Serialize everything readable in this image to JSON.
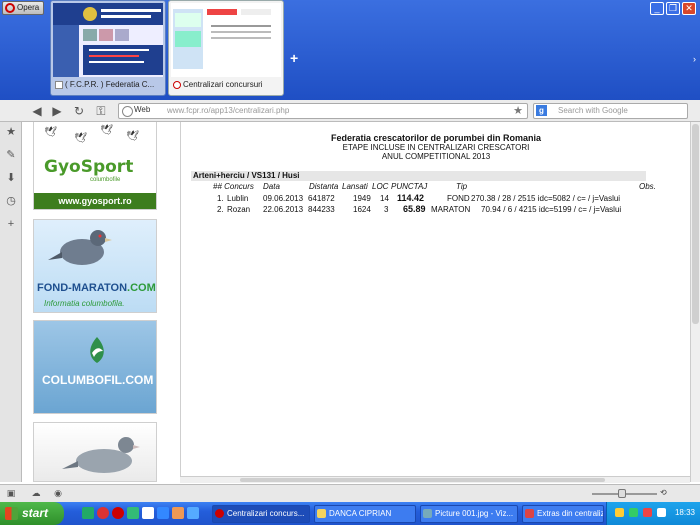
{
  "browser": {
    "menu_label": "Opera",
    "tabs": [
      {
        "label": "( F.C.P.R. ) Federatia C..."
      },
      {
        "label": "Centralizari concursuri"
      }
    ],
    "new_tab_label": "+",
    "address": {
      "scheme_label": "Web",
      "url_host": "www.fcpr.ro",
      "url_path": "/app13/centralizari.php"
    },
    "search_placeholder": "Search with Google",
    "search_engine": "g"
  },
  "sidebar_ads": [
    {
      "brand": "GyoSport",
      "sub": "columbofile",
      "strip": "www.gyosport.ro"
    },
    {
      "brand_a": "FOND-MARATON",
      "brand_b": ".COM",
      "sub": "Informatia columbofila."
    },
    {
      "brand": "COLUMBOFIL.COM"
    }
  ],
  "page": {
    "title": "Federatia crescatorilor de porumbei din Romania",
    "subtitle": "ETAPE INCLUSE IN CENTRALIZARI CRESCATORI",
    "season": "ANUL COMPETITIONAL 2013",
    "group_header": "Arteni+herciu / VS131 / Husi",
    "columns": [
      "## Concurs",
      "Data",
      "Distanta",
      "Lansati",
      "LOC",
      "PUNCTAJ",
      "Tip",
      "Obs."
    ],
    "rows": [
      {
        "nr": "1.",
        "concurs": "Lublin",
        "data": "09.06.2013",
        "distanta": "641872",
        "lansati": "1949",
        "loc": "14",
        "punctaj": "114.42",
        "tip": "FOND",
        "obs": "270.38 / 28 / 2515 idc=5082 / c= / j=Vaslui"
      },
      {
        "nr": "2.",
        "concurs": "Rozan",
        "data": "22.06.2013",
        "distanta": "844233",
        "lansati": "1624",
        "loc": "3",
        "punctaj": "65.89",
        "tip": "MARATON",
        "obs": "70.94 / 6 / 4215 idc=5199 / c= / j=Vaslui"
      }
    ]
  },
  "taskbar": {
    "start_label": "start",
    "tasks": [
      {
        "label": "Centralizari concurs..."
      },
      {
        "label": "DANCA CIPRIAN"
      },
      {
        "label": "Picture 001.jpg - Viz..."
      },
      {
        "label": "Extras din centraliza..."
      }
    ],
    "clock": "18:33"
  },
  "colors": {
    "titlebar": "#1f4fc4",
    "taskbar": "#245edb",
    "start": "#2f8f2a",
    "opera_red": "#cc0000"
  }
}
